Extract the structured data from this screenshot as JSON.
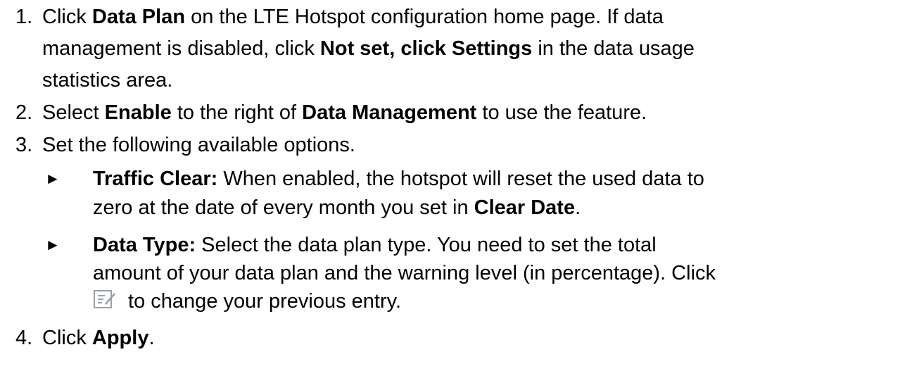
{
  "steps": [
    {
      "number": "1.",
      "lines": [
        [
          {
            "text": "Click ",
            "bold": false
          },
          {
            "text": "Data Plan",
            "bold": true
          },
          {
            "text": " on the LTE Hotspot configuration home page. If data",
            "bold": false
          }
        ],
        [
          {
            "text": "management is disabled, click ",
            "bold": false
          },
          {
            "text": "Not set, click Settings",
            "bold": true
          },
          {
            "text": " in the data usage",
            "bold": false
          }
        ],
        [
          {
            "text": "statistics area.",
            "bold": false
          }
        ]
      ]
    },
    {
      "number": "2.",
      "lines": [
        [
          {
            "text": "Select ",
            "bold": false
          },
          {
            "text": "Enable",
            "bold": true
          },
          {
            "text": " to the right of ",
            "bold": false
          },
          {
            "text": "Data Management",
            "bold": true
          },
          {
            "text": " to use the feature.",
            "bold": false
          }
        ]
      ]
    },
    {
      "number": "3.",
      "lines": [
        [
          {
            "text": "Set the following available options.",
            "bold": false
          }
        ]
      ]
    },
    {
      "number": "4.",
      "lines": [
        [
          {
            "text": "Click ",
            "bold": false
          },
          {
            "text": "Apply",
            "bold": true
          },
          {
            "text": ".",
            "bold": false
          }
        ]
      ]
    }
  ],
  "bullet_symbol": "►",
  "bullets": [
    {
      "lines": [
        [
          {
            "text": "Traffic Clear:",
            "bold": true
          },
          {
            "text": " When enabled, the hotspot will reset the used data to",
            "bold": false
          }
        ],
        [
          {
            "text": "zero at the date of every month you set in ",
            "bold": false
          },
          {
            "text": "Clear Date",
            "bold": true
          },
          {
            "text": ".",
            "bold": false
          }
        ]
      ]
    },
    {
      "lines": [
        [
          {
            "text": "Data Type:",
            "bold": true
          },
          {
            "text": " Select the data plan type. You need to set the total",
            "bold": false
          }
        ],
        [
          {
            "text": "amount of your data plan and the warning level (in percentage). Click",
            "bold": false
          }
        ],
        [
          {
            "text": " to change your previous entry.",
            "bold": false
          }
        ]
      ]
    }
  ],
  "icons": {
    "edit": "edit-icon",
    "edit_color": "#9aa0a6"
  }
}
